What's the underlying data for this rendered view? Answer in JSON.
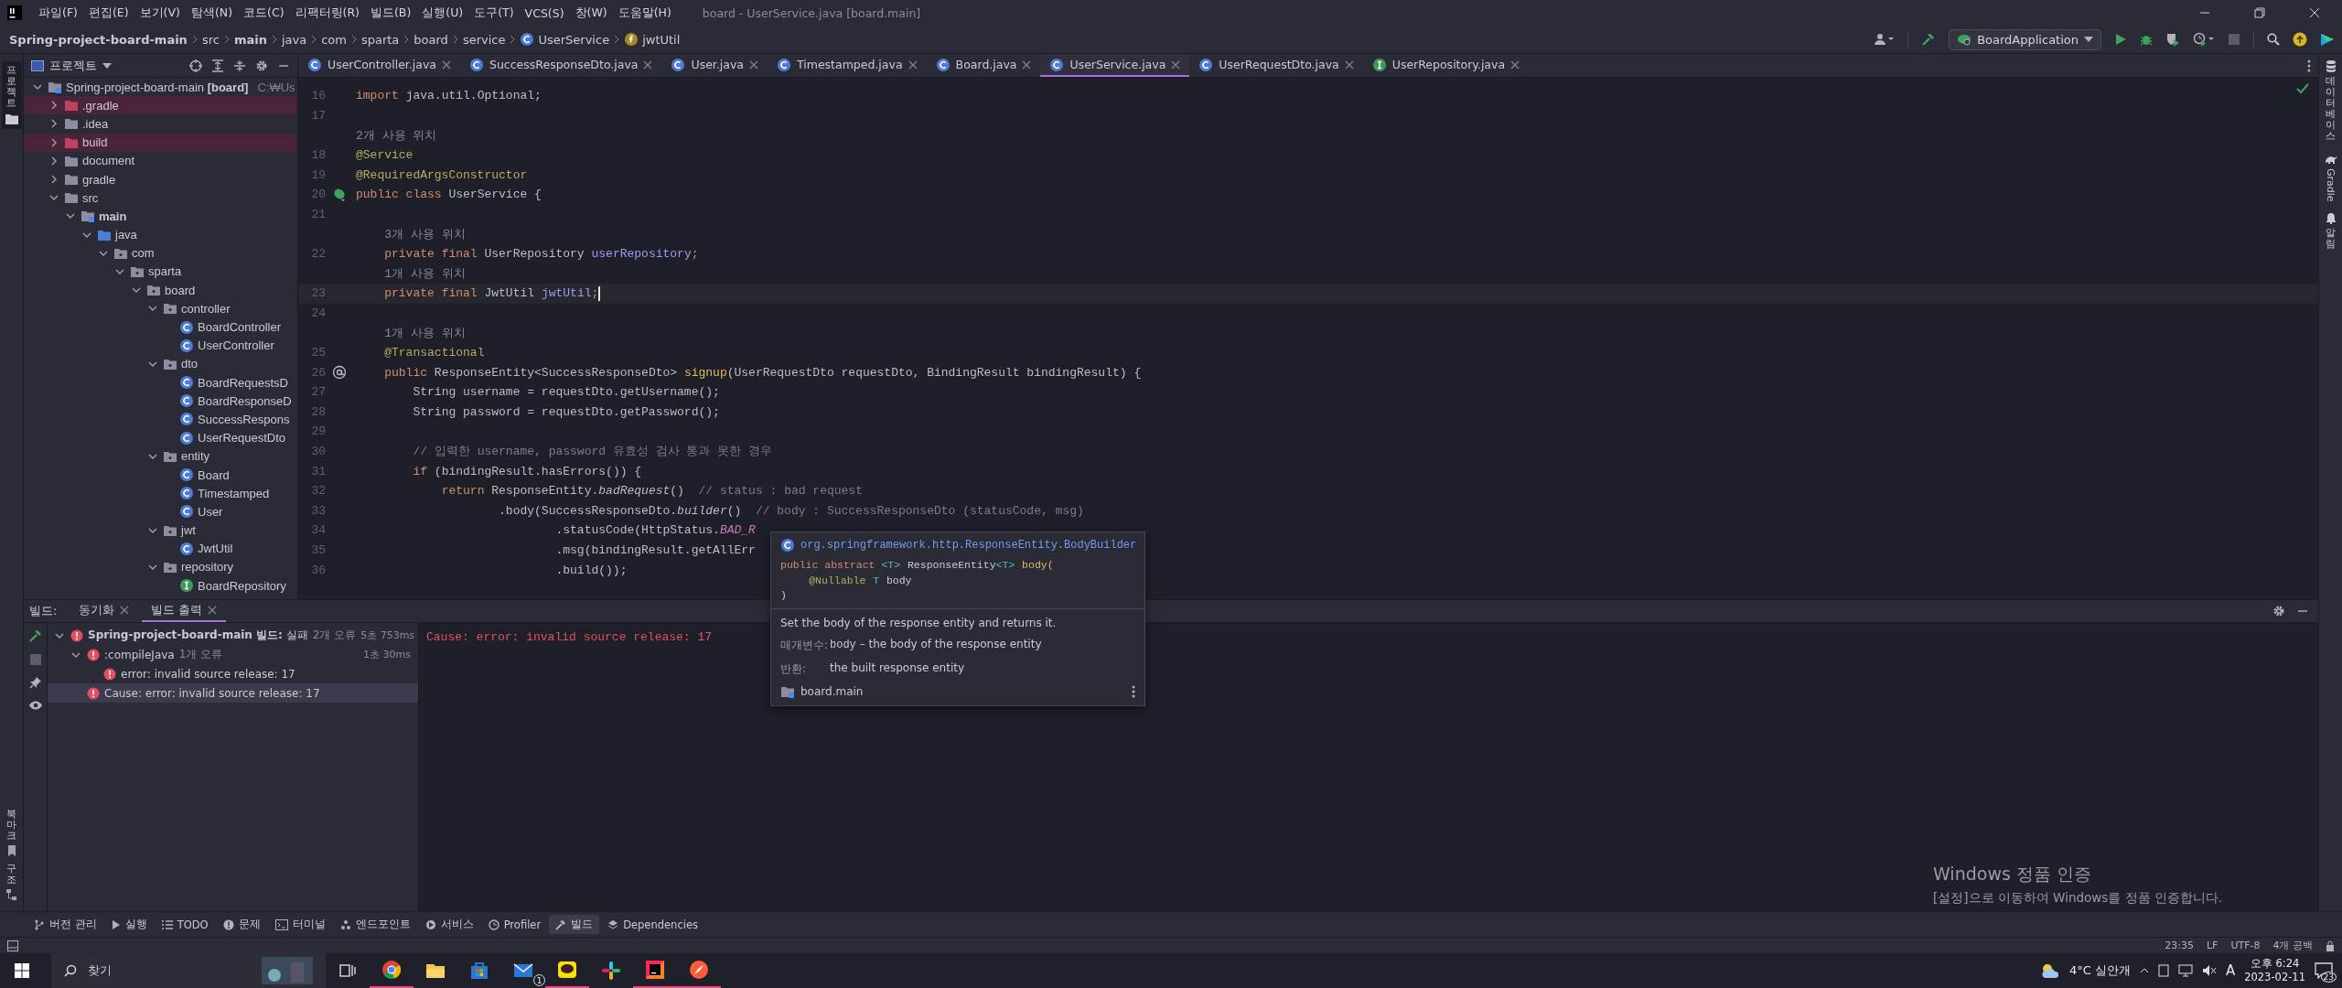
{
  "title_bar": {
    "menus": [
      "파일(F)",
      "편집(E)",
      "보기(V)",
      "탐색(N)",
      "코드(C)",
      "리팩터링(R)",
      "빌드(B)",
      "실행(U)",
      "도구(T)",
      "VCS(S)",
      "창(W)",
      "도움말(H)"
    ],
    "title": "board - UserService.java [board.main]"
  },
  "navigation_bar": {
    "breadcrumbs": [
      {
        "label": "Spring-project-board-main",
        "kind": "bold"
      },
      {
        "label": "src",
        "kind": "plain"
      },
      {
        "label": "main",
        "kind": "bold"
      },
      {
        "label": "java",
        "kind": "plain"
      },
      {
        "label": "com",
        "kind": "plain"
      },
      {
        "label": "sparta",
        "kind": "plain"
      },
      {
        "label": "board",
        "kind": "plain"
      },
      {
        "label": "service",
        "kind": "plain"
      },
      {
        "label": "UserService",
        "kind": "class"
      },
      {
        "label": "jwtUtil",
        "kind": "field"
      }
    ],
    "run_configuration": "BoardApplication"
  },
  "side_strips": {
    "left_top": "프로젝트",
    "left_bottom": [
      "북마크",
      "구조"
    ],
    "right": [
      {
        "label": "데이터베이스",
        "kind": "database"
      },
      {
        "label": "Gradle",
        "kind": "gradle"
      },
      {
        "label": "알림",
        "kind": "bell"
      }
    ]
  },
  "project_panel": {
    "title": "프로젝트",
    "tree": [
      {
        "label": "Spring-project-board-main **[board]**",
        "path": "C:₩Us",
        "kind": "module",
        "expanded": true,
        "children": [
          {
            "label": ".gradle",
            "kind": "excluded",
            "expanded": false
          },
          {
            "label": ".idea",
            "kind": "folder",
            "expanded": false
          },
          {
            "label": "build",
            "kind": "excluded",
            "expanded": false
          },
          {
            "label": "document",
            "kind": "folder",
            "expanded": false
          },
          {
            "label": "gradle",
            "kind": "folder",
            "expanded": false
          },
          {
            "label": "src",
            "kind": "folder",
            "expanded": true,
            "children": [
              {
                "label": "main",
                "kind": "module-folder",
                "bold": true,
                "expanded": true,
                "children": [
                  {
                    "label": "java",
                    "kind": "source",
                    "expanded": true,
                    "children": [
                      {
                        "label": "com",
                        "kind": "package",
                        "expanded": true,
                        "children": [
                          {
                            "label": "sparta",
                            "kind": "package",
                            "expanded": true,
                            "children": [
                              {
                                "label": "board",
                                "kind": "package",
                                "expanded": true,
                                "children": [
                                  {
                                    "label": "controller",
                                    "kind": "package",
                                    "expanded": true,
                                    "children": [
                                      {
                                        "label": "BoardController",
                                        "kind": "class"
                                      },
                                      {
                                        "label": "UserController",
                                        "kind": "class"
                                      }
                                    ]
                                  },
                                  {
                                    "label": "dto",
                                    "kind": "package",
                                    "expanded": true,
                                    "children": [
                                      {
                                        "label": "BoardRequestsD",
                                        "kind": "class"
                                      },
                                      {
                                        "label": "BoardResponseD",
                                        "kind": "class"
                                      },
                                      {
                                        "label": "SuccessRespons",
                                        "kind": "class"
                                      },
                                      {
                                        "label": "UserRequestDto",
                                        "kind": "class"
                                      }
                                    ]
                                  },
                                  {
                                    "label": "entity",
                                    "kind": "package",
                                    "expanded": true,
                                    "children": [
                                      {
                                        "label": "Board",
                                        "kind": "class"
                                      },
                                      {
                                        "label": "Timestamped",
                                        "kind": "class"
                                      },
                                      {
                                        "label": "User",
                                        "kind": "class"
                                      }
                                    ]
                                  },
                                  {
                                    "label": "jwt",
                                    "kind": "package",
                                    "expanded": true,
                                    "children": [
                                      {
                                        "label": "JwtUtil",
                                        "kind": "class"
                                      }
                                    ]
                                  },
                                  {
                                    "label": "repository",
                                    "kind": "package",
                                    "expanded": true,
                                    "children": [
                                      {
                                        "label": "BoardRepository",
                                        "kind": "interface"
                                      }
                                    ]
                                  }
                                ]
                              }
                            ]
                          }
                        ]
                      }
                    ]
                  }
                ]
              }
            ]
          }
        ]
      }
    ]
  },
  "editor": {
    "tabs": [
      {
        "label": "UserController.java",
        "kind": "class",
        "selected": false
      },
      {
        "label": "SuccessResponseDto.java",
        "kind": "class",
        "selected": false
      },
      {
        "label": "User.java",
        "kind": "class",
        "selected": false
      },
      {
        "label": "Timestamped.java",
        "kind": "class",
        "selected": false
      },
      {
        "label": "Board.java",
        "kind": "class",
        "selected": false
      },
      {
        "label": "UserService.java",
        "kind": "class",
        "selected": true
      },
      {
        "label": "UserRequestDto.java",
        "kind": "class",
        "selected": false
      },
      {
        "label": "UserRepository.java",
        "kind": "interface",
        "selected": false
      }
    ],
    "lines": [
      {
        "number": "16",
        "tokens": [
          {
            "kind": "keyword",
            "text": "import"
          },
          {
            "kind": "plain",
            "text": " java.util.Optional;"
          }
        ]
      },
      {
        "number": "17"
      },
      {
        "tokens": [
          {
            "kind": "hint",
            "text": "2개 사용 위치"
          }
        ]
      },
      {
        "number": "18",
        "tokens": [
          {
            "kind": "annotation",
            "text": "@Service"
          }
        ]
      },
      {
        "number": "19",
        "tokens": [
          {
            "kind": "annotation",
            "text": "@RequiredArgsConstructor"
          }
        ]
      },
      {
        "number": "20",
        "gutter": {
          "kind": "bean"
        },
        "tokens": [
          {
            "kind": "keyword",
            "text": "public class"
          },
          {
            "kind": "plain",
            "text": " UserService {"
          }
        ]
      },
      {
        "number": "21"
      },
      {
        "tokens": [
          {
            "kind": "hint",
            "text": "    3개 사용 위치"
          }
        ]
      },
      {
        "number": "22",
        "tokens": [
          {
            "kind": "keyword",
            "text": "    private final"
          },
          {
            "kind": "plain",
            "text": " UserRepository "
          },
          {
            "kind": "field",
            "text": "userRepository"
          },
          {
            "kind": "keyword",
            "text": ";"
          }
        ]
      },
      {
        "tokens": [
          {
            "kind": "hint",
            "text": "    1개 사용 위치"
          }
        ]
      },
      {
        "number": "23",
        "current": true,
        "tokens": [
          {
            "kind": "keyword",
            "text": "    private final"
          },
          {
            "kind": "plain",
            "text": " JwtUtil "
          },
          {
            "kind": "field",
            "text": "jwtUtil"
          },
          {
            "kind": "keyword",
            "text": ";"
          }
        ]
      },
      {
        "number": "24"
      },
      {
        "tokens": [
          {
            "kind": "hint",
            "text": "    1개 사용 위치"
          }
        ]
      },
      {
        "number": "25",
        "tokens": [
          {
            "kind": "annotation",
            "text": "    @Transactional"
          }
        ]
      },
      {
        "number": "26",
        "gutter": {
          "kind": "at"
        },
        "tokens": [
          {
            "kind": "keyword",
            "text": "    public"
          },
          {
            "kind": "plain",
            "text": " ResponseEntity<SuccessResponseDto> "
          },
          {
            "kind": "method",
            "text": "signup"
          },
          {
            "kind": "plain",
            "text": "(UserRequestDto requestDto, BindingResult bindingResult) {"
          }
        ]
      },
      {
        "number": "27",
        "tokens": [
          {
            "kind": "plain",
            "text": "        String username = requestDto.getUsername();"
          }
        ]
      },
      {
        "number": "28",
        "tokens": [
          {
            "kind": "plain",
            "text": "        String password = requestDto.getPassword();"
          }
        ]
      },
      {
        "number": "29"
      },
      {
        "number": "30",
        "tokens": [
          {
            "kind": "comment",
            "text": "        // 입력한 username, password 유효성 검사 통과 못한 경우"
          }
        ]
      },
      {
        "number": "31",
        "tokens": [
          {
            "kind": "keyword",
            "text": "        if"
          },
          {
            "kind": "plain",
            "text": " (bindingResult.hasErrors()) {"
          }
        ]
      },
      {
        "number": "32",
        "tokens": [
          {
            "kind": "keyword",
            "text": "            return"
          },
          {
            "kind": "plain",
            "text": " ResponseEntity."
          },
          {
            "kind": "italic",
            "text": "badRequest"
          },
          {
            "kind": "plain",
            "text": "()  "
          },
          {
            "kind": "comment",
            "text": "// status : bad request"
          }
        ]
      },
      {
        "number": "33",
        "tokens": [
          {
            "kind": "plain",
            "text": "                    .body(SuccessResponseDto."
          },
          {
            "kind": "italic",
            "text": "builder"
          },
          {
            "kind": "plain",
            "text": "()  "
          },
          {
            "kind": "comment",
            "text": "// body : SuccessResponseDto (statusCode, msg)"
          }
        ]
      },
      {
        "number": "34",
        "tokens": [
          {
            "kind": "plain",
            "text": "                            .statusCode(HttpStatus."
          },
          {
            "kind": "constant",
            "text": "BAD_R"
          }
        ]
      },
      {
        "number": "35",
        "tokens": [
          {
            "kind": "plain",
            "text": "                            .msg(bindingResult.getAllErr"
          }
        ]
      },
      {
        "number": "36",
        "tokens": [
          {
            "kind": "plain",
            "text": "                            .build());"
          }
        ]
      }
    ]
  },
  "doc_popup": {
    "header": "org.springframework.http.ResponseEntity.BodyBuilder",
    "signature": [
      [
        {
          "kind": "keyword",
          "text": "public abstract "
        },
        {
          "kind": "type",
          "text": "<T>"
        },
        {
          "kind": "plain",
          "text": " ResponseEntity"
        },
        {
          "kind": "type",
          "text": "<T>"
        },
        {
          "kind": "method",
          "text": " body("
        }
      ],
      [
        {
          "kind": "annotation",
          "text": "    @Nullable"
        },
        {
          "kind": "type",
          "text": " T"
        },
        {
          "kind": "plain",
          "text": " body"
        }
      ],
      [
        {
          "kind": "plain",
          "text": ")"
        }
      ]
    ],
    "description": "Set the body of the response entity and returns it.",
    "params_label": "매개변수:",
    "param_name": "body",
    "param_text": "– the body of the response entity",
    "returns_label": "반환:",
    "returns_text": "the built response entity",
    "module": "board.main"
  },
  "build_panel": {
    "label": "빌드:",
    "tabs": [
      {
        "label": "동기화",
        "selected": false
      },
      {
        "label": "빌드 출력",
        "selected": true
      }
    ],
    "tree": [
      {
        "label": "**Spring-project-board-main 빌드:** 실패",
        "summary": "2개 오류",
        "time": "5초 753ms",
        "expanded": true,
        "selected": false,
        "children": [
          {
            "label": ":compileJava",
            "summary": "1개 오류",
            "time": "1초 30ms",
            "expanded": true,
            "selected": false,
            "children": [
              {
                "label": "error: invalid source release: 17",
                "selected": false
              }
            ]
          },
          {
            "label": "Cause: error: invalid source release: 17",
            "selected": true
          }
        ]
      }
    ],
    "console": "Cause: error: invalid source release: 17"
  },
  "activation_notice": {
    "title": "Windows 정품 인증",
    "text": "[설정]으로 이동하여 Windows를 정품 인증합니다."
  },
  "tool_window_bar": [
    {
      "label": "버전 관리",
      "kind": "branch",
      "selected": false
    },
    {
      "label": "실행",
      "kind": "run",
      "selected": false
    },
    {
      "label": "TODO",
      "kind": "list",
      "selected": false
    },
    {
      "label": "문제",
      "kind": "problem",
      "selected": false
    },
    {
      "label": "터미널",
      "kind": "terminal",
      "selected": false
    },
    {
      "label": "엔드포인트",
      "kind": "endpoints",
      "selected": false
    },
    {
      "label": "서비스",
      "kind": "services",
      "selected": false
    },
    {
      "label": "Profiler",
      "kind": "profiler",
      "selected": false
    },
    {
      "label": "빌드",
      "kind": "hammer",
      "selected": true
    },
    {
      "label": "Dependencies",
      "kind": "dependencies",
      "selected": false
    }
  ],
  "status_bar": [
    "23:35",
    "LF",
    "UTF-8",
    "4개 공백"
  ],
  "taskbar": {
    "search_placeholder": "찾기",
    "mail_badge": "1",
    "weather": "4°C 실안개",
    "ime": "A",
    "time": "오후 6:24",
    "date": "2023-02-11",
    "notifications": "23"
  }
}
